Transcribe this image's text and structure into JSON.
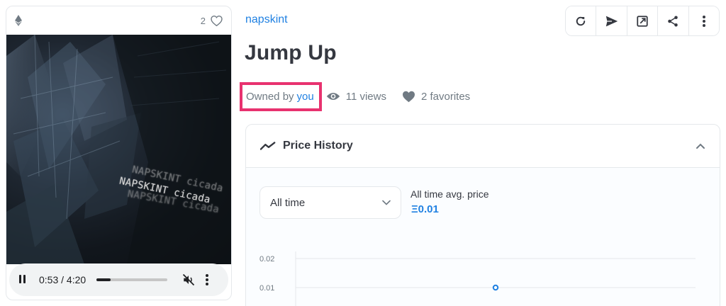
{
  "media": {
    "favorite_count": "2",
    "artwork_caption": "NAPSKINT cicada",
    "player": {
      "time": "0:53 / 4:20",
      "progress": 0.2
    }
  },
  "item": {
    "collection": "napskint",
    "title": "Jump Up",
    "owned_by_label": "Owned by",
    "owner": "you",
    "views": "11 views",
    "favorites": "2 favorites"
  },
  "actions": [
    "refresh-icon",
    "send-icon",
    "external-link-icon",
    "share-icon",
    "more-icon"
  ],
  "price_history": {
    "title": "Price History",
    "range_select": "All time",
    "avg_label": "All time avg. price",
    "avg_value": "0.01",
    "currency_symbol": "Ξ"
  },
  "chart_data": {
    "type": "scatter",
    "title": "",
    "xlabel": "",
    "ylabel": "",
    "y_ticks": [
      "0.02",
      "0.01"
    ],
    "points": [
      {
        "y": 0.01
      }
    ]
  },
  "colors": {
    "accent": "#2081e2",
    "highlight_border": "#e8326f",
    "text": "#353840",
    "muted": "#707a83"
  }
}
